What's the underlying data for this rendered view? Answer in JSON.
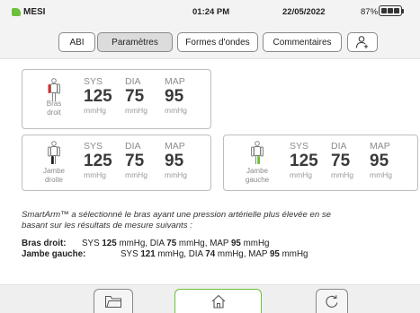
{
  "status": {
    "brand": "MESI",
    "time": "01:24 PM",
    "date": "22/05/2022",
    "battery": "87%",
    "brand_color": "#6cbf3a"
  },
  "tabs": [
    {
      "label": "ABI",
      "active": false
    },
    {
      "label": "Paramètres",
      "active": true
    },
    {
      "label": "Formes d'ondes",
      "active": false
    },
    {
      "label": "Commentaires",
      "active": false
    }
  ],
  "tab_icons": {
    "add_user": "user-plus-icon"
  },
  "measurements": {
    "headers": {
      "sys": "SYS",
      "dia": "DIA",
      "map": "MAP"
    },
    "unit": "mmHg",
    "arm": {
      "label_line1": "Bras",
      "label_line2": "droit",
      "sys": "125",
      "dia": "75",
      "map": "95",
      "indicator_color": "#d0312d"
    },
    "right_leg": {
      "label_line1": "Jambe",
      "label_line2": "droite",
      "sys": "125",
      "dia": "75",
      "map": "95",
      "indicator_color": "#222222"
    },
    "left_leg": {
      "label_line1": "Jambe",
      "label_line2": "gauche",
      "sys": "125",
      "dia": "75",
      "map": "95",
      "indicator_color": "#6cbf3a"
    }
  },
  "notes": {
    "text_line1": "SmartArm™ a sélectionné le bras ayant une pression artérielle plus élevée en se",
    "text_line2": "basant sur les résultats de mesure suivants :",
    "results": [
      {
        "label": "Bras droit:",
        "sys_prefix": "SYS",
        "sys": "125",
        "dia_prefix": "mmHg, DIA",
        "dia": "75",
        "map_prefix": "mmHg, MAP",
        "map": "95",
        "suffix": "mmHg"
      },
      {
        "label": "Jambe gauche:",
        "sys_prefix": "SYS",
        "sys": "121",
        "dia_prefix": "mmHg, DIA",
        "dia": "74",
        "map_prefix": "mmHg, MAP",
        "map": "95",
        "suffix": "mmHg"
      }
    ]
  },
  "bottom": {
    "icons": [
      "folder-icon",
      "home-icon",
      "refresh-icon"
    ],
    "accent": "#6cbf3a"
  }
}
